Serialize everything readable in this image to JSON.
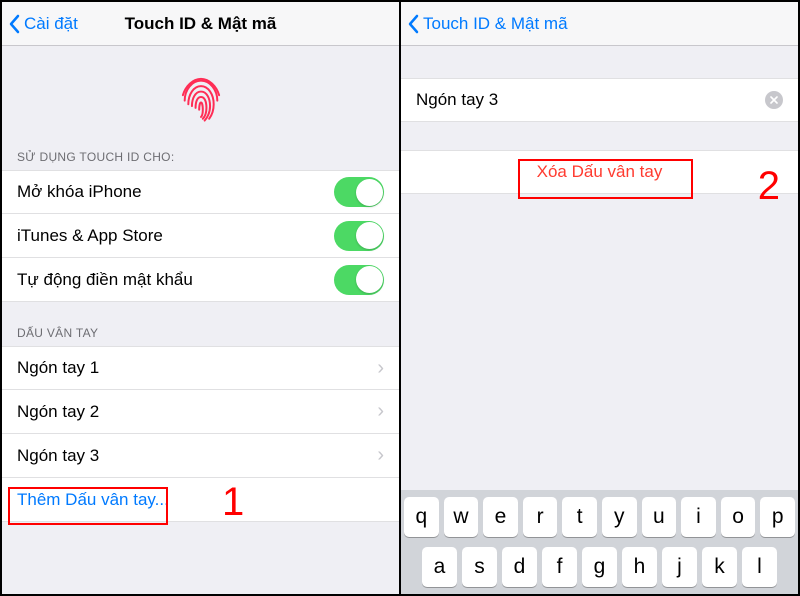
{
  "left": {
    "back_label": "Cài đặt",
    "title": "Touch ID & Mật mã",
    "section_use": "SỬ DỤNG TOUCH ID CHO:",
    "toggles": [
      {
        "label": "Mở khóa iPhone"
      },
      {
        "label": "iTunes & App Store"
      },
      {
        "label": "Tự động điền mật khẩu"
      }
    ],
    "section_fingers": "DẤU VÂN TAY",
    "fingers": [
      {
        "label": "Ngón tay 1"
      },
      {
        "label": "Ngón tay 2"
      },
      {
        "label": "Ngón tay 3"
      }
    ],
    "add_label": "Thêm Dấu vân tay...",
    "step_num": "1"
  },
  "right": {
    "back_label": "Touch ID & Mật mã",
    "input_value": "Ngón tay 3",
    "delete_label": "Xóa Dấu vân tay",
    "step_num": "2",
    "keyboard": {
      "row1": [
        "q",
        "w",
        "e",
        "r",
        "t",
        "y",
        "u",
        "i",
        "o",
        "p"
      ],
      "row2": [
        "a",
        "s",
        "d",
        "f",
        "g",
        "h",
        "j",
        "k",
        "l"
      ]
    }
  }
}
